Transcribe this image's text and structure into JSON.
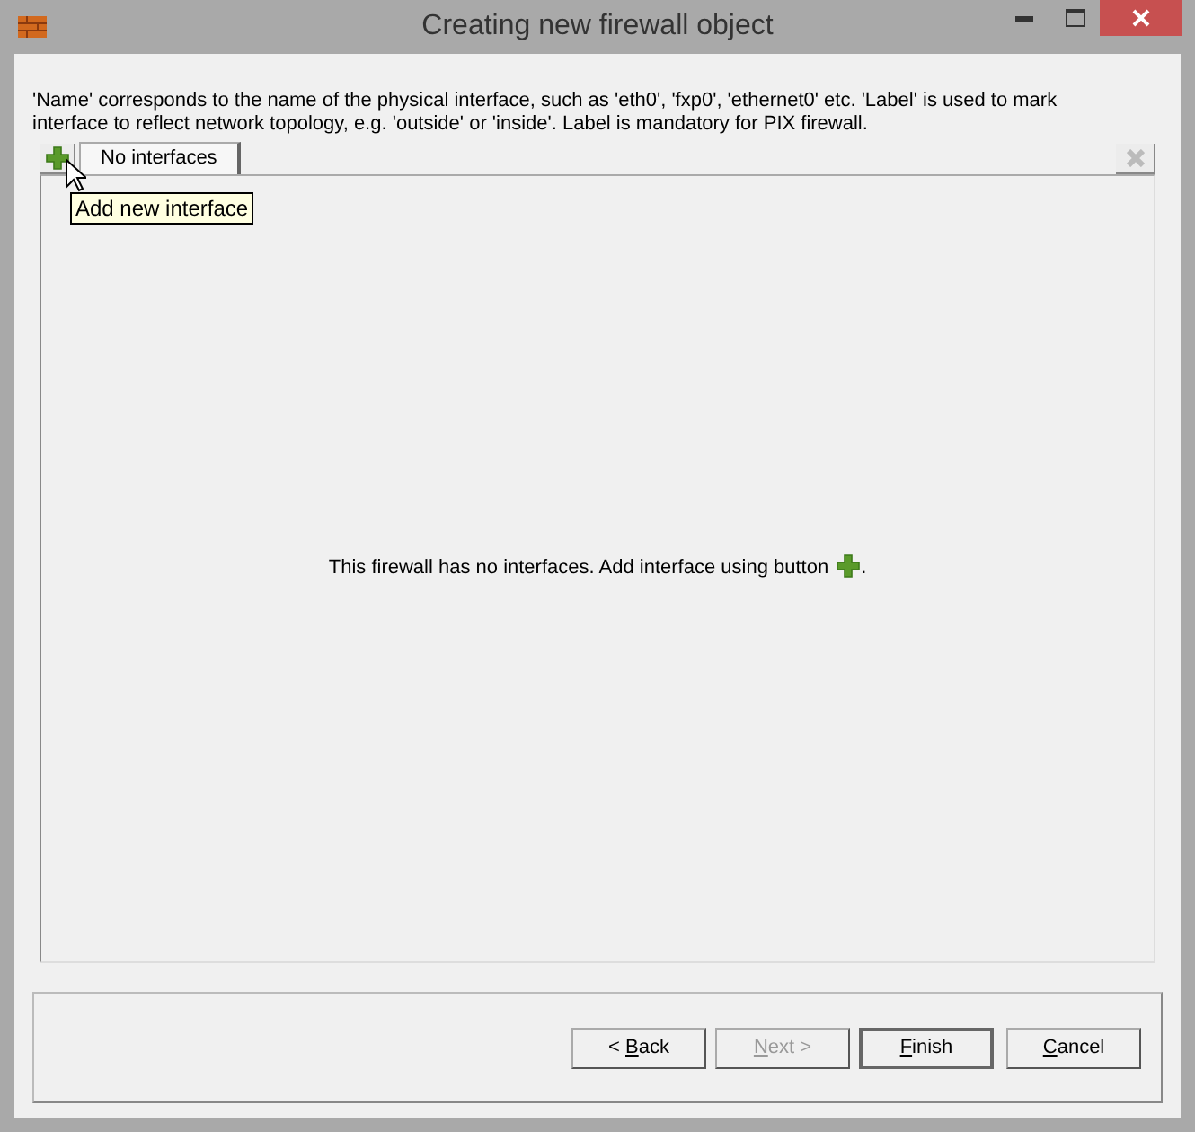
{
  "window": {
    "title": "Creating new firewall object"
  },
  "description": "'Name' corresponds to the name of the physical interface, such as 'eth0', 'fxp0', 'ethernet0' etc. 'Label' is used to mark interface to reflect network topology, e.g. 'outside' or 'inside'. Label is mandatory for PIX firewall.",
  "tabs": [
    {
      "label": "No interfaces",
      "selected": true
    }
  ],
  "tooltip": "Add new interface",
  "delete_disabled": true,
  "message": {
    "before": "This firewall has no interfaces. Add interface using button",
    "after": "."
  },
  "buttons": [
    {
      "pre": "< ",
      "key": "B",
      "post": "ack",
      "disabled": false,
      "default": false
    },
    {
      "key": "N",
      "post": "ext >",
      "disabled": true,
      "default": false
    },
    {
      "key": "F",
      "post": "inish",
      "disabled": false,
      "default": true
    },
    {
      "key": "C",
      "post": "ancel",
      "disabled": false,
      "default": false
    }
  ]
}
